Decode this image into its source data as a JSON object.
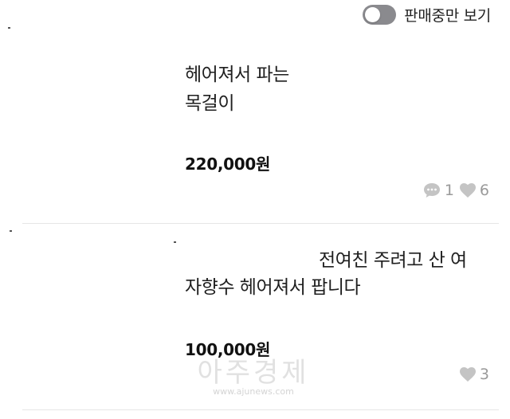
{
  "filter": {
    "label": "판매중만 보기",
    "toggle_on": false
  },
  "listings": [
    {
      "title_lines": [
        "헤어져서 파는",
        "목걸이"
      ],
      "price": "220,000원",
      "comments": "1",
      "likes": "6"
    },
    {
      "title_lines": [
        "전여친 주려고 산 여",
        "자향수 헤어져서 팝니다"
      ],
      "price": "100,000원",
      "likes": "3"
    }
  ],
  "icons": {
    "comment": "comment-bubble-icon",
    "like": "heart-icon"
  },
  "colors": {
    "toggle_off": "#8a8a8e",
    "muted": "#9a9a9a",
    "divider": "#e6e6e6"
  },
  "watermark": {
    "name": "아주경제",
    "url": "www.ajunews.com"
  }
}
